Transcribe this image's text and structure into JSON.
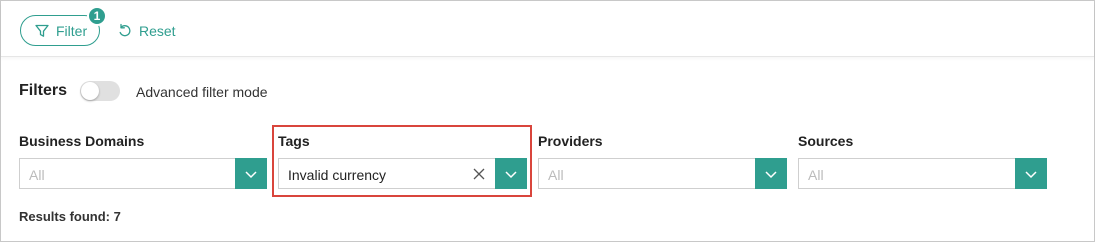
{
  "toolbar": {
    "filter_label": "Filter",
    "filter_badge": "1",
    "reset_label": "Reset"
  },
  "filters": {
    "title": "Filters",
    "advanced_mode_label": "Advanced filter mode",
    "advanced_mode_on": false
  },
  "groups": [
    {
      "label": "Business Domains",
      "value": "",
      "placeholder": "All"
    },
    {
      "label": "Tags",
      "value": "Invalid currency",
      "placeholder": "All"
    },
    {
      "label": "Providers",
      "value": "",
      "placeholder": "All"
    },
    {
      "label": "Sources",
      "value": "",
      "placeholder": "All"
    }
  ],
  "results_text": "Results found: 7",
  "colors": {
    "accent": "#2f9e8f",
    "highlight": "#d9453c"
  }
}
